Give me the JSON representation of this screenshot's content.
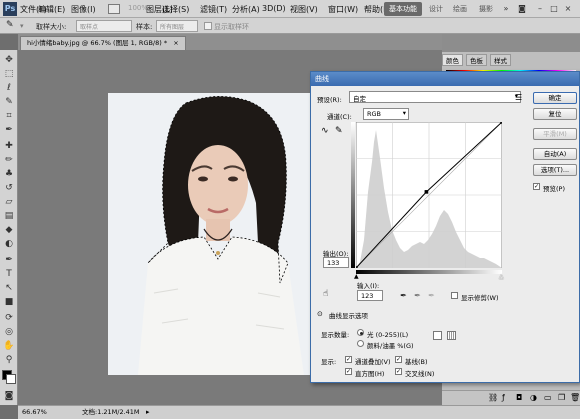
{
  "app": {
    "logo": "Ps",
    "menu": [
      "文件(F)",
      "编辑(E)",
      "图像(I)",
      "图层(L)",
      "选择(S)",
      "滤镜(T)",
      "分析(A)",
      "3D(D)",
      "视图(V)",
      "窗口(W)",
      "帮助(H)"
    ],
    "zoom_menu": "100%",
    "workspaces": [
      "基本功能",
      "设计",
      "绘画",
      "摄影"
    ],
    "active_workspace": "基本功能"
  },
  "options_bar": {
    "sample_size_label": "取样大小:",
    "sample_size_value": "取样点",
    "sample_label": "样本:",
    "sample_value": "所有图层",
    "show_ring_label": "显示取样环"
  },
  "document": {
    "tab_title": "hi小情绪baby.jpg @ 66.7% (图层 1, RGB/8) *"
  },
  "status": {
    "zoom": "66.67%",
    "doc_info": "文档:1.21M/2.41M"
  },
  "panels": {
    "tabs": [
      "颜色",
      "色板",
      "样式"
    ],
    "active_tab": "颜色"
  },
  "curves": {
    "title": "曲线",
    "preset_label": "预设(R):",
    "preset_value": "自定",
    "channel_label": "通道(C):",
    "channel_value": "RGB",
    "output_label": "输出(O):",
    "output_value": "133",
    "input_label": "输入(I):",
    "input_value": "123",
    "show_clipping_label": "显示修剪(W)",
    "display_options_label": "曲线显示选项",
    "show_amount_label": "显示数量:",
    "light_label": "光 (0-255)(L)",
    "pigment_label": "颜料/油墨 %(G)",
    "show_label": "显示:",
    "show_channel_overlays": "通道叠加(V)",
    "show_baseline": "基线(B)",
    "show_histogram": "直方图(H)",
    "show_intersection": "交叉线(N)",
    "buttons": {
      "ok": "确定",
      "reset": "复位",
      "smooth": "平滑(M)",
      "auto": "自动(A)",
      "options": "选项(T)...",
      "preview": "预览(P)"
    },
    "curve_points": [
      [
        0,
        0
      ],
      [
        123,
        133
      ],
      [
        255,
        255
      ]
    ]
  }
}
